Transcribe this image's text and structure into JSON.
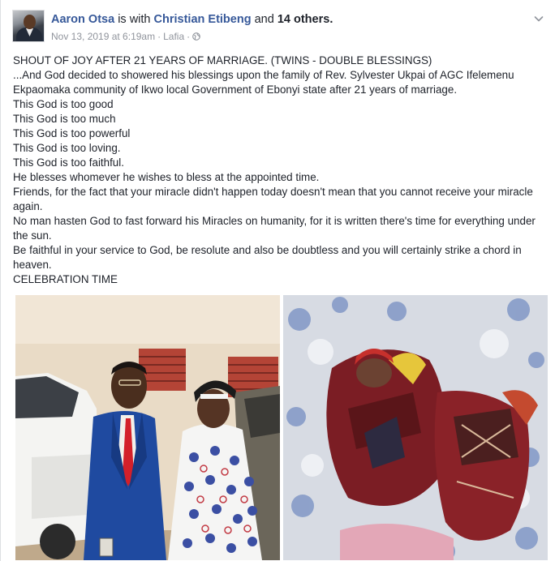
{
  "post": {
    "author": "Aaron Otsa",
    "with_text": "is with",
    "tagged_person": "Christian Etibeng",
    "and_text": "and",
    "others": "14 others.",
    "timestamp": "Nov 13, 2019 at 6:19am",
    "location": "Lafia",
    "privacy_icon": "globe-icon",
    "menu_icon": "chevron-down-icon",
    "body_lines": [
      "SHOUT OF JOY AFTER 21 YEARS OF MARRIAGE. (TWINS - DOUBLE BLESSINGS)",
      "...And God decided to showered his blessings upon the family of Rev. Sylvester Ukpai of AGC Ifelemenu Ekpaomaka community of Ikwo local Government of Ebonyi state after 21 years of marriage.",
      "This God is too good",
      "This God is too much",
      "This God is too powerful",
      "This God is too loving.",
      "This God is too faithful.",
      "He blesses whomever he wishes to bless at the appointed time.",
      "Friends, for the fact that your miracle didn't happen today doesn't mean that you cannot receive your miracle again.",
      "No man hasten God to fast forward his Miracles on humanity, for it is written there's time for everything under the sun.",
      "Be faithful in your service to God, be resolute and also be doubtless and you will certainly strike a chord in heaven.",
      "CELEBRATION TIME"
    ]
  },
  "colors": {
    "link_name": "#365899",
    "meta_gray": "#90949c",
    "text": "#1d2129"
  }
}
